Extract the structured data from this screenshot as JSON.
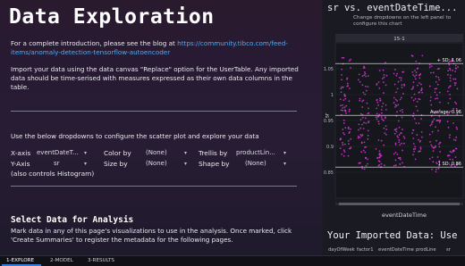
{
  "left": {
    "title": "Data Exploration",
    "intro_text": "For a complete introduction, please see the blog at ",
    "intro_link": "https://community.tibco.com/feed-items/anomaly-detection-tensorflow-autoencoder",
    "import_text": "Import your data using the data canvas \"Replace\" option for the UserTable. Any imported data should be time-serised with measures expressed as their own data columns in the table.",
    "dropdowns_text": "Use the below dropdowns to configure the scatter plot and explore your data",
    "controls": {
      "xaxis_label": "X-axis",
      "xaxis_value": "eventDateT...",
      "yaxis_label": "Y-Axis",
      "yaxis_value": "sr",
      "color_label": "Color by",
      "color_value": "(None)",
      "size_label": "Size by",
      "size_value": "(None)",
      "trellis_label": "Trellis by",
      "trellis_value": "productLin...",
      "shape_label": "Shape by",
      "shape_value": "(None)",
      "histogram_note": "(also controls Histogram)"
    },
    "select_heading": "Select Data for Analysis",
    "select_text": "Mark data in any of this page's visualizations to use in the analysis. Once marked, click 'Create Summaries' to register the metadata for the following pages."
  },
  "chart": {
    "title": "sr vs. eventDateTime...",
    "subtitle": "Change dropdowns on the left panel to configure this chart",
    "panel_label": "15-1",
    "ylabel": "sr",
    "xlabel": "eventDateTime",
    "yticks": [
      "1.05",
      "1",
      "0.95",
      "0.9",
      "0.85"
    ],
    "ref_lines": [
      "+ SD: 1.06",
      "Average: 0.96",
      "-1 SD: 0.86"
    ],
    "color": "#d63ad6"
  },
  "chart_data": {
    "type": "scatter",
    "title": "sr vs. eventDateTime...",
    "xlabel": "eventDateTime",
    "ylabel": "sr",
    "ylim": [
      0.8,
      1.1
    ],
    "yticks": [
      1.05,
      1.0,
      0.95,
      0.9,
      0.85
    ],
    "reference_lines": [
      {
        "label": "+ SD",
        "value": 1.06
      },
      {
        "label": "Average",
        "value": 0.96
      },
      {
        "label": "-1 SD",
        "value": 0.86
      }
    ],
    "series": [
      {
        "name": "15-1",
        "color": "#d63ad6",
        "clusters": [
          {
            "x": 0.08,
            "y_low": 0.88,
            "y_high": 1.08
          },
          {
            "x": 0.22,
            "y_low": 0.85,
            "y_high": 1.06
          },
          {
            "x": 0.36,
            "y_low": 0.86,
            "y_high": 1.07
          },
          {
            "x": 0.5,
            "y_low": 0.86,
            "y_high": 1.05
          },
          {
            "x": 0.64,
            "y_low": 0.87,
            "y_high": 1.08
          },
          {
            "x": 0.78,
            "y_low": 0.85,
            "y_high": 1.06
          },
          {
            "x": 0.92,
            "y_low": 0.86,
            "y_high": 1.07
          }
        ]
      }
    ]
  },
  "imported": {
    "title": "Your Imported Data: Use",
    "columns": [
      "dayOfWeek",
      "factor1",
      "eventDateTime",
      "prodLine",
      "sr"
    ]
  },
  "tabs": [
    "1-EXPLORE",
    "2-MODEL",
    "3-RESULTS"
  ]
}
